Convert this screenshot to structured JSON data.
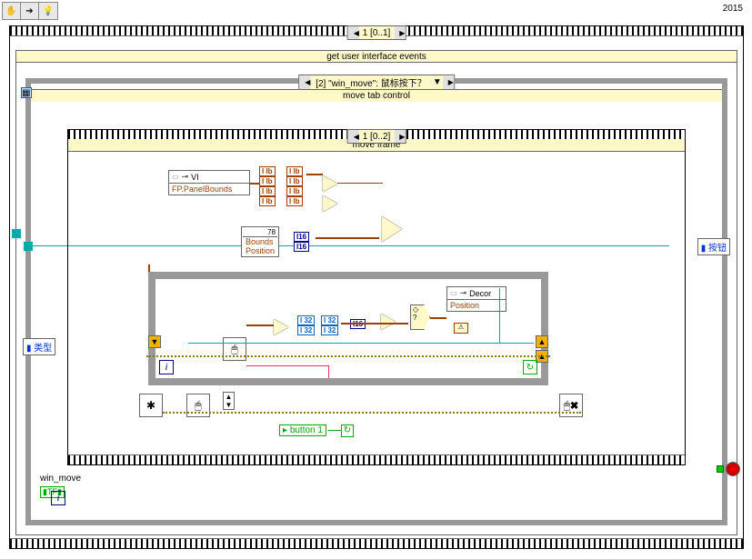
{
  "toolbar": {
    "hand": "✋",
    "arrow": "➔",
    "bulb": "💡"
  },
  "year": "2015",
  "outer_frame_sel": "1 [0..1]",
  "event_title": "get user interface events",
  "case_label": "[2] \"win_move\": 鼠标按下？",
  "case_subtitle": "move tab control",
  "mid_frame_sel": "1 [0..2]",
  "mid_title": "move frame",
  "vi_node": {
    "hdr": "VI",
    "row1": "FP.PanelBounds"
  },
  "bounds_node": {
    "r1": "Bounds",
    "r2": "Position"
  },
  "decor_node": {
    "hdr": "Decor",
    "row1": "Position"
  },
  "i16": "I16",
  "ilb": "I lb",
  "left_pane_text": "类型",
  "right_pane_text": "按钮",
  "win_move_label": "win_move",
  "tf_label": "TF",
  "button1": "button 1",
  "sel_glyph": "◇\n?",
  "mouse1": "🖱",
  "mouse2": "🖱",
  "mouse3": "🖱",
  "mouse_x": "🖱✖",
  "asterisk": "✱",
  "num78": "78"
}
